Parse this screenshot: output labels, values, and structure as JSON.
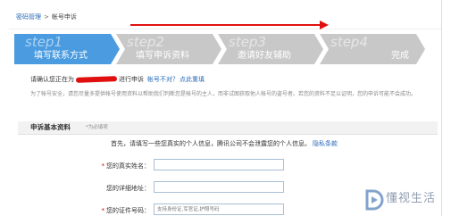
{
  "colors": {
    "accent": "#4a9be0",
    "step_inactive": "#c8c8c8",
    "link": "#2a6bb8",
    "required": "#e00000",
    "annotation": "#e01010"
  },
  "breadcrumb": {
    "parent": "密码管理",
    "separator": ">",
    "current": "帐号申诉"
  },
  "steps": [
    {
      "num": "step1",
      "label": "填写联系方式",
      "active": true
    },
    {
      "num": "step2",
      "label": "填写申诉资料",
      "active": false
    },
    {
      "num": "step3",
      "label": "邀请好友辅助",
      "active": false
    },
    {
      "num": "step4",
      "label": "完成",
      "active": false
    }
  ],
  "confirm": {
    "prefix": "请确认您正在为",
    "suffix": "进行申诉",
    "wrong_account": "帐号不对？",
    "refill": "点此重填"
  },
  "notice": "为了帐号安全，请您尽量多提供帐号使用资料以帮助我们判断您是帐号的主人，而非试图获取他人帐号的盗号者。若您的资料不足以证明，您的申诉可能不会成功。",
  "section": {
    "title": "申诉基本资料",
    "required_note": "*为必填项"
  },
  "intro": {
    "text": "首先，请填写一些您真实的个人信息，腾讯公司不会泄露您的个人信息。",
    "privacy_link": "隐私条款"
  },
  "fields": [
    {
      "required": "*",
      "label": "您的真实姓名：",
      "value": "",
      "placeholder": ""
    },
    {
      "required": "",
      "label": "您的详细地址：",
      "value": "",
      "placeholder": ""
    },
    {
      "required": "*",
      "label": "您的证件号码：",
      "value": "",
      "placeholder": "支持身份证,军官证,护照号码"
    }
  ],
  "watermark": {
    "icon": "play-d-logo-icon",
    "text": "懂视生活"
  }
}
